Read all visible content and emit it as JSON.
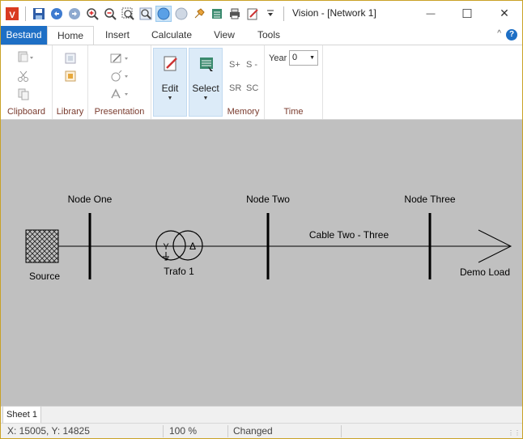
{
  "window": {
    "title": "Vision - [Network 1]",
    "min_glyph": "—",
    "max_glyph": "☐",
    "close_glyph": "✕"
  },
  "qat_icons": [
    "app-logo-icon",
    "save-icon",
    "undo-icon",
    "redo-icon",
    "zoom-in-icon",
    "zoom-out-icon",
    "zoom-window-icon",
    "zoom-fit-icon",
    "select-mode-icon",
    "circle-icon",
    "pin-icon",
    "stack-icon",
    "print-icon",
    "edit-note-icon",
    "customize-dropdown-icon"
  ],
  "tabs": {
    "file": "Bestand",
    "home": "Home",
    "insert": "Insert",
    "calculate": "Calculate",
    "view": "View",
    "tools": "Tools",
    "help": "?",
    "collapse": "^"
  },
  "ribbon": {
    "clipboard": "Clipboard",
    "library": "Library",
    "presentation": "Presentation",
    "edit": "Edit",
    "select": "Select",
    "memory": "Memory",
    "time": "Time",
    "s_plus": "S+",
    "s_minus": "S -",
    "sr": "SR",
    "sc": "SC",
    "year_label": "Year",
    "year_value": "0"
  },
  "diagram": {
    "nodes": [
      {
        "name": "Node One"
      },
      {
        "name": "Node Two"
      },
      {
        "name": "Node Three"
      }
    ],
    "source": "Source",
    "transformer": "Trafo 1",
    "cable": "Cable Two - Three",
    "load": "Demo Load",
    "trafo_primary_symbol": "Y",
    "trafo_secondary_symbol": "Δ"
  },
  "sheet": {
    "tab": "Sheet 1"
  },
  "status": {
    "coords": "X: 15005, Y: 14825",
    "zoom": "100 %",
    "state": "Changed"
  },
  "colors": {
    "accent": "#1e6fc5",
    "canvas": "#c0c0c0",
    "group_label": "#7a3b2e"
  }
}
